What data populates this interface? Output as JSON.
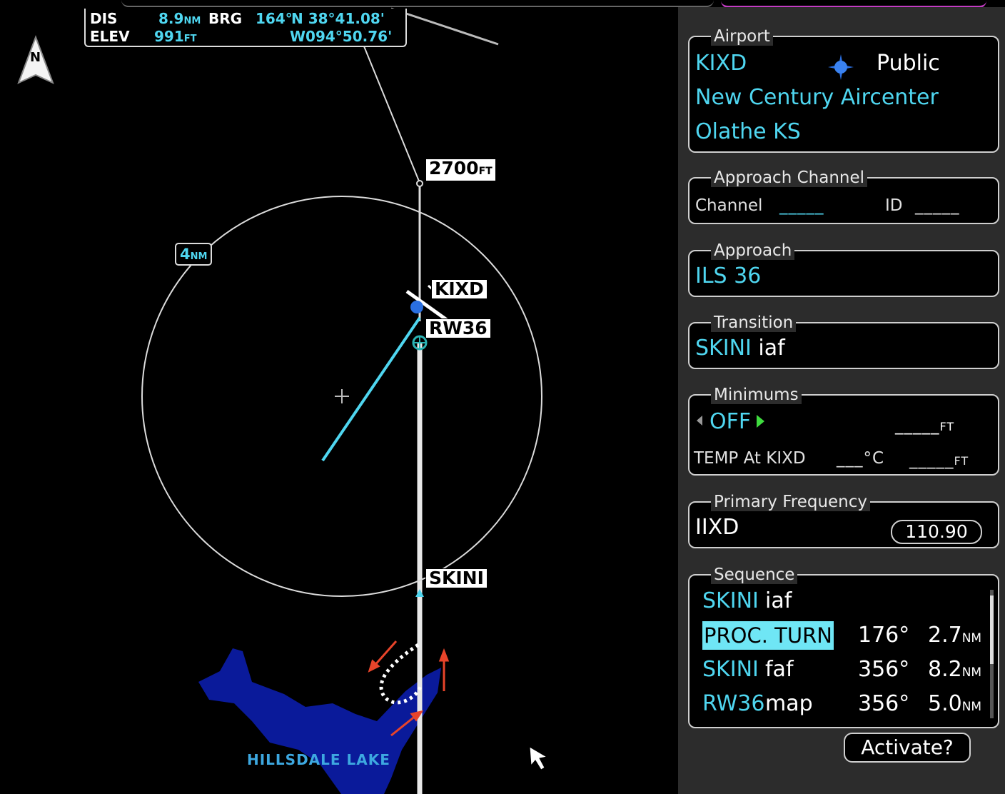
{
  "map": {
    "info": {
      "dis_label": "DIS",
      "dis_value": "8.9",
      "dis_unit": "NM",
      "brg_label": "BRG",
      "brg_value": "164°",
      "lat": "N 38°41.08'",
      "elev_label": "ELEV",
      "elev_value": "991",
      "elev_unit": "FT",
      "lon": "W094°50.76'"
    },
    "north_label": "N",
    "altitude_label": "2700",
    "altitude_unit": "FT",
    "ring_value": "4",
    "ring_unit": "NM",
    "airport_label": "KIXD",
    "runway_label": "RW36",
    "fix_label": "SKINI",
    "lake_label": "HILLSDALE LAKE"
  },
  "panel": {
    "airport": {
      "title": "Airport",
      "ident": "KIXD",
      "type": "Public",
      "name": "New Century Aircenter",
      "city": "Olathe KS"
    },
    "approach_channel": {
      "title": "Approach Channel",
      "channel_label": "Channel",
      "channel_value": "_____",
      "id_label": "ID",
      "id_value": "_____"
    },
    "approach": {
      "title": "Approach",
      "value": "ILS 36"
    },
    "transition": {
      "title": "Transition",
      "fix": "SKINI",
      "suffix": "iaf"
    },
    "minimums": {
      "title": "Minimums",
      "mode": "OFF",
      "value": "_____",
      "unit": "FT",
      "temp_label": "TEMP At KIXD",
      "temp_value": "___",
      "temp_unit": "°C",
      "temp_alt": "_____",
      "temp_alt_unit": "FT"
    },
    "primary_frequency": {
      "title": "Primary Frequency",
      "ident": "IIXD",
      "frequency": "110.90"
    },
    "sequence": {
      "title": "Sequence",
      "rows": [
        {
          "fix": "SKINI",
          "type": "iaf",
          "course": "",
          "dist": "",
          "unit": ""
        },
        {
          "fix": "PROC. TURN",
          "type": "",
          "course": "176°",
          "dist": "2.7",
          "unit": "NM"
        },
        {
          "fix": "SKINI",
          "type": "faf",
          "course": "356°",
          "dist": "8.2",
          "unit": "NM"
        },
        {
          "fix": "RW36",
          "type": "map",
          "course": "356°",
          "dist": "5.0",
          "unit": "NM"
        }
      ]
    },
    "activate_label": "Activate?"
  },
  "colors": {
    "cyan": "#4fd6f0",
    "highlight": "#6fe6f5",
    "green": "#3fdc3f",
    "lake": "#0a1a9a",
    "magenta": "#e040e0",
    "annotation_red": "#e8442a"
  }
}
